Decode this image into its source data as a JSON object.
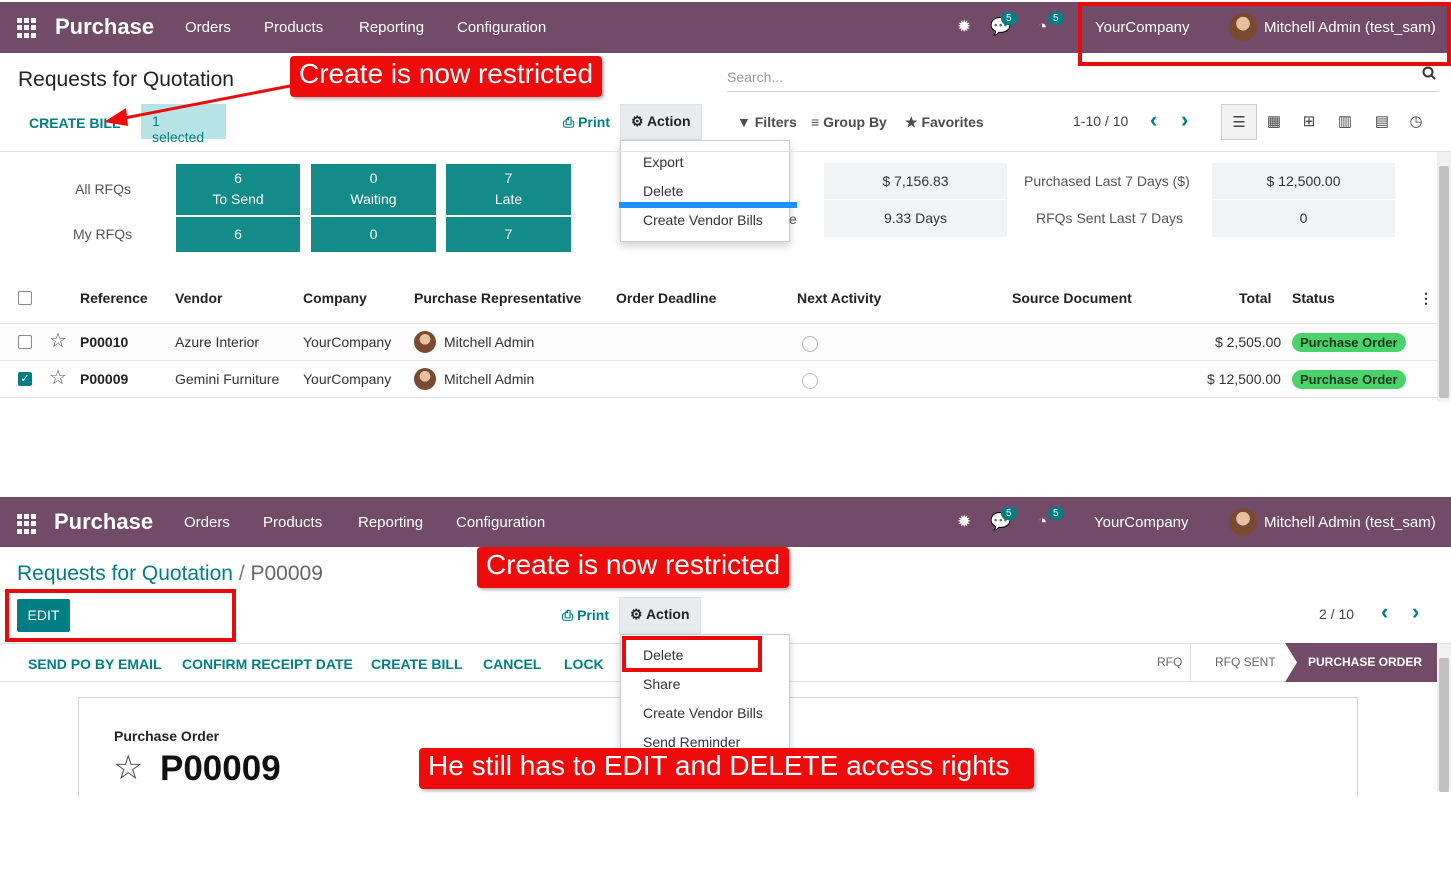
{
  "top": {
    "navbar": {
      "brand": "Purchase",
      "menus": [
        "Orders",
        "Products",
        "Reporting",
        "Configuration"
      ],
      "chat_count": "5",
      "activity_count": "5",
      "company": "YourCompany",
      "user": "Mitchell Admin (test_sam)"
    },
    "breadcrumb": "Requests for Quotation",
    "create_bill": "CREATE BILL",
    "selected": "1 selected",
    "print": "Print",
    "action": "Action",
    "action_menu": [
      "Export",
      "Delete",
      "Create Vendor Bills"
    ],
    "search_placeholder": "Search...",
    "filters": "Filters",
    "group_by": "Group By",
    "favorites": "Favorites",
    "pager": "1-10 / 10",
    "callout": "Create is now restricted",
    "dashboard": {
      "row_labels": [
        "All RFQs",
        "My RFQs"
      ],
      "tiles": [
        {
          "value": "6",
          "label": "To Send",
          "mine": "6"
        },
        {
          "value": "0",
          "label": "Waiting",
          "mine": "0"
        },
        {
          "value": "7",
          "label": "Late",
          "mine": "7"
        }
      ],
      "partial_label": "e",
      "stats": {
        "avg_value": "$ 7,156.83",
        "days": "9.33  Days",
        "purchased_label": "Purchased Last 7 Days ($)",
        "purchased_value": "$ 12,500.00",
        "sent_label": "RFQs Sent Last 7 Days",
        "sent_value": "0"
      }
    },
    "table": {
      "headers": [
        "Reference",
        "Vendor",
        "Company",
        "Purchase Representative",
        "Order Deadline",
        "Next Activity",
        "Source Document",
        "Total",
        "Status"
      ],
      "rows": [
        {
          "ref": "P00010",
          "vendor": "Azure Interior",
          "company": "YourCompany",
          "rep": "Mitchell Admin",
          "total": "$ 2,505.00",
          "status": "Purchase Order",
          "checked": false
        },
        {
          "ref": "P00009",
          "vendor": "Gemini Furniture",
          "company": "YourCompany",
          "rep": "Mitchell Admin",
          "total": "$ 12,500.00",
          "status": "Purchase Order",
          "checked": true
        }
      ]
    }
  },
  "bottom": {
    "navbar": {
      "brand": "Purchase",
      "menus": [
        "Orders",
        "Products",
        "Reporting",
        "Configuration"
      ],
      "chat_count": "5",
      "activity_count": "5",
      "company": "YourCompany",
      "user": "Mitchell Admin (test_sam)"
    },
    "breadcrumb_parent": "Requests for Quotation",
    "breadcrumb_sep": "/",
    "breadcrumb_current": "P00009",
    "edit": "EDIT",
    "print": "Print",
    "action": "Action",
    "action_menu": [
      "Delete",
      "Share",
      "Create Vendor Bills",
      "Send Reminder"
    ],
    "pager": "2 / 10",
    "status_buttons": [
      "SEND PO BY EMAIL",
      "CONFIRM RECEIPT DATE",
      "CREATE BILL",
      "CANCEL",
      "LOCK"
    ],
    "stages": [
      "RFQ",
      "RFQ SENT",
      "PURCHASE ORDER"
    ],
    "form_type": "Purchase Order",
    "form_title": "P00009",
    "callout": "Create is now restricted",
    "callout2": "He still has to EDIT and DELETE access rights"
  },
  "colors": {
    "brand": "#714B67",
    "accent": "#017e84",
    "callout": "#ed0b0b",
    "status": "#4bd36b"
  }
}
